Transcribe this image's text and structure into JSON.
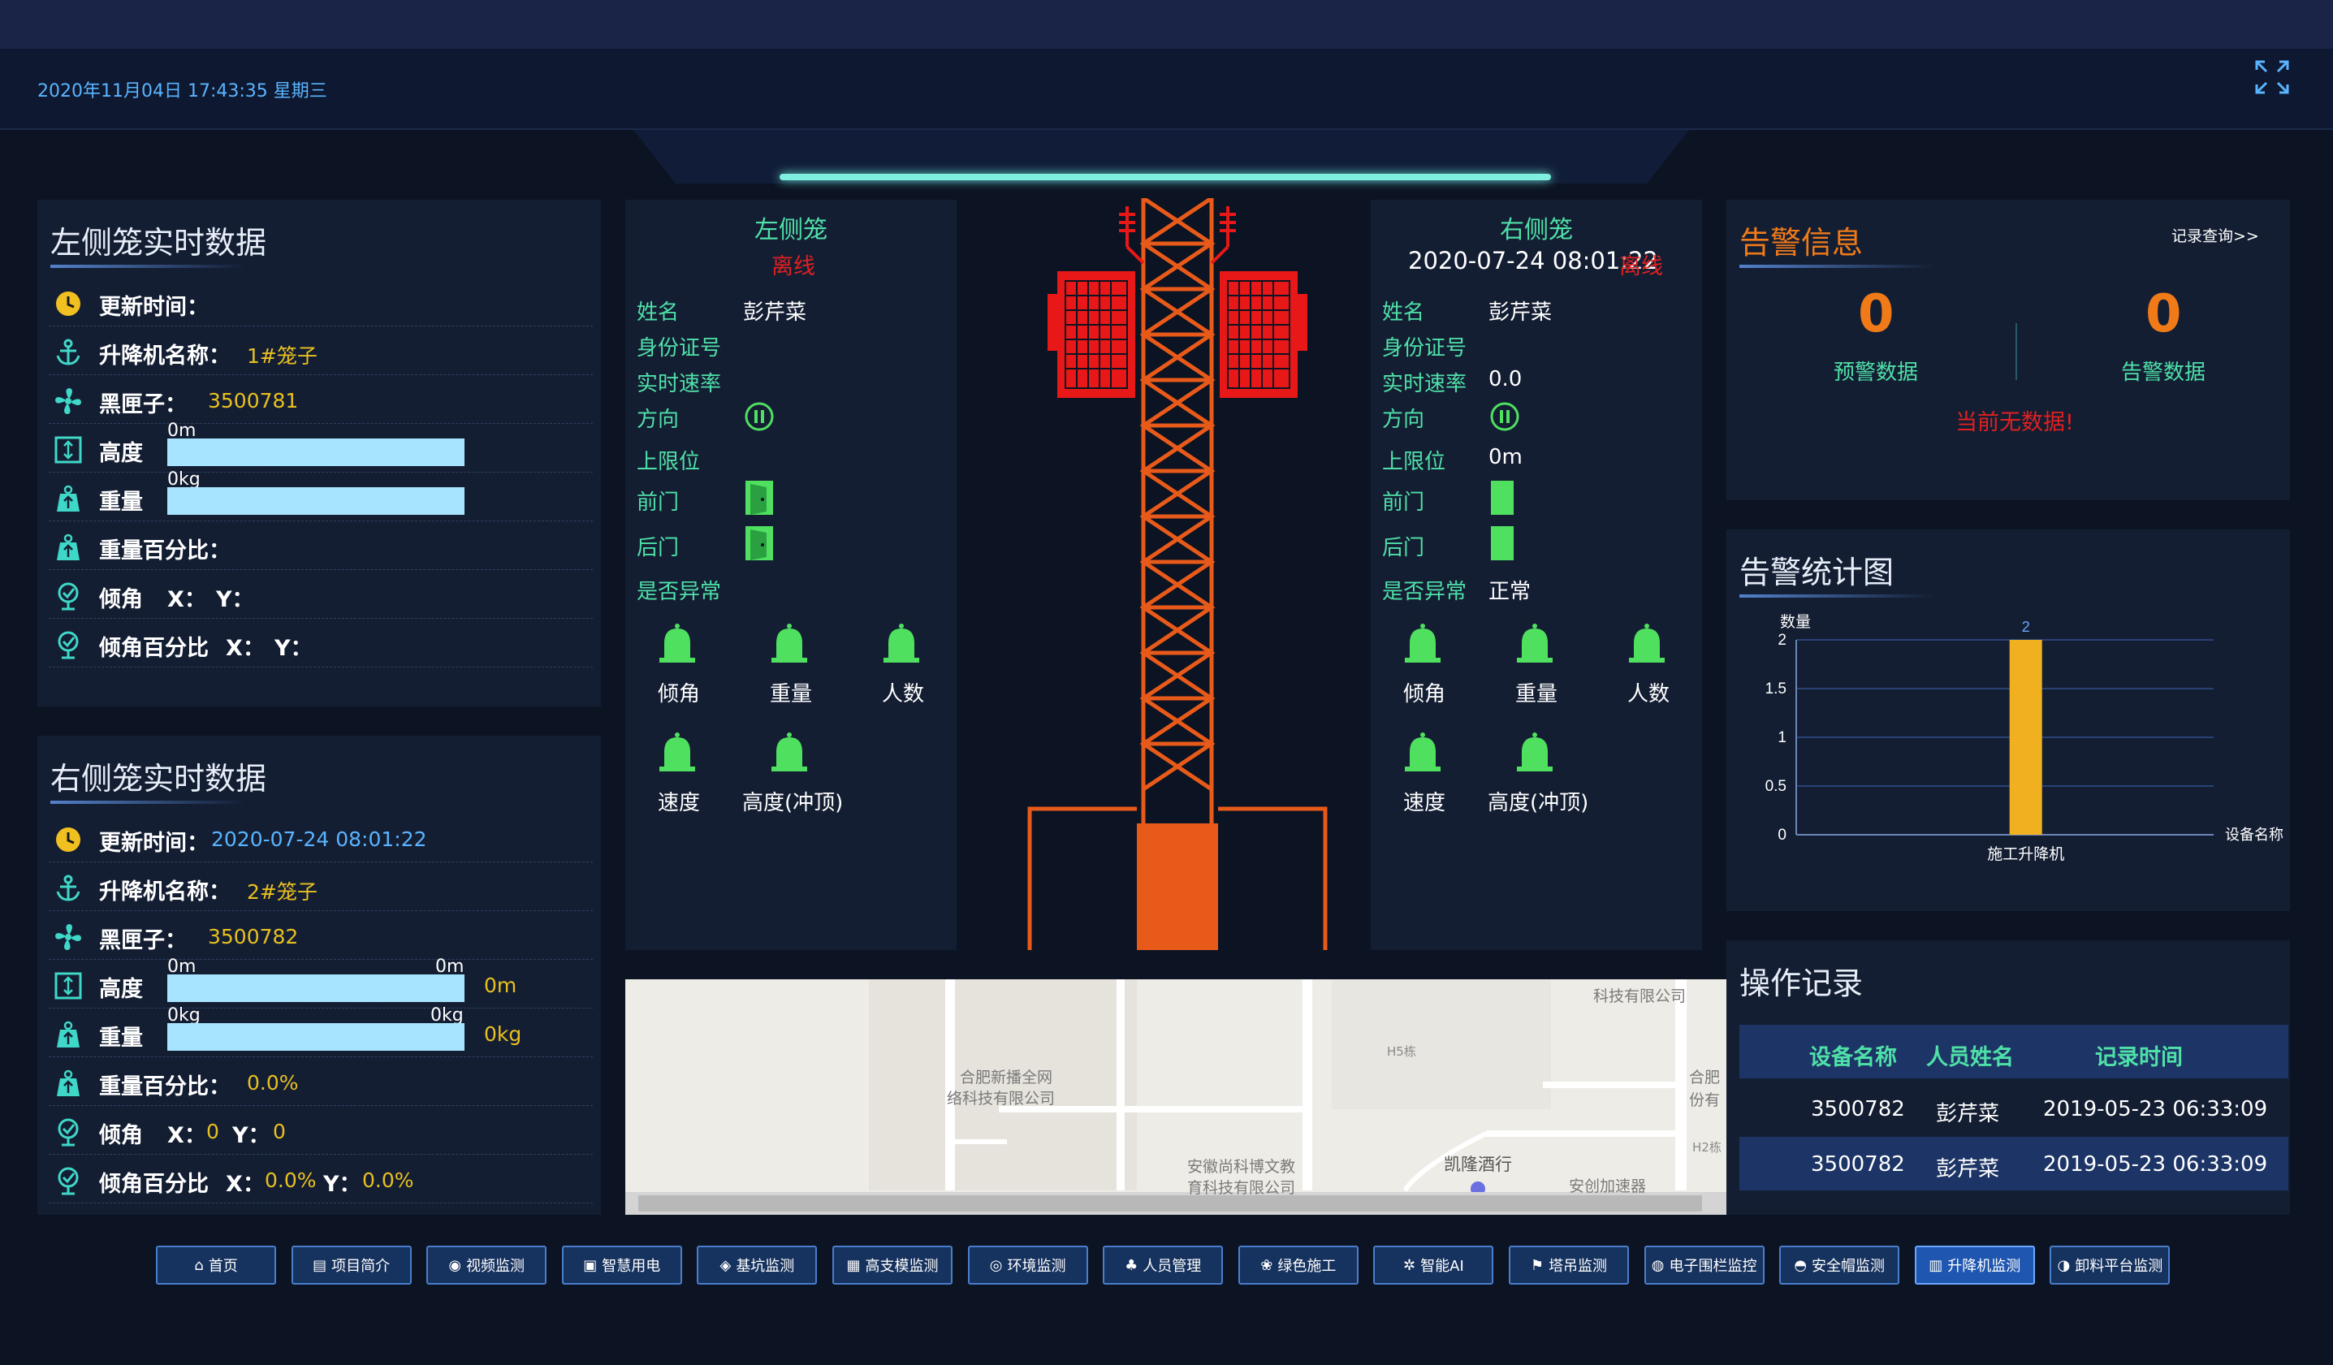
{
  "header": {
    "datetime": "2020年11月04日 17:43:35  星期三"
  },
  "left_data": {
    "title": "左侧笼实时数据",
    "update_label": "更新时间：",
    "update_value": "",
    "hoist_label": "升降机名称：",
    "hoist_value": "1#笼子",
    "blackbox_label": "黑匣子：",
    "blackbox_value": "3500781",
    "height_label": "高度",
    "height_bar_left": "0m",
    "weight_label": "重量",
    "weight_bar_left": "0kg",
    "weight_pct_label": "重量百分比：",
    "tilt_label": "倾角",
    "tilt_x": "X：",
    "tilt_y": "Y：",
    "tilt_pct_label": "倾角百分比",
    "tilt_pct_x": "X：",
    "tilt_pct_y": "Y："
  },
  "right_data": {
    "title": "右侧笼实时数据",
    "update_label": "更新时间：",
    "update_value": "2020-07-24 08:01:22",
    "hoist_label": "升降机名称：",
    "hoist_value": "2#笼子",
    "blackbox_label": "黑匣子：",
    "blackbox_value": "3500782",
    "height_label": "高度",
    "height_bar_left": "0m",
    "height_bar_right": "0m",
    "height_value": "0m",
    "weight_label": "重量",
    "weight_bar_left": "0kg",
    "weight_bar_right": "0kg",
    "weight_value": "0kg",
    "weight_pct_label": "重量百分比：",
    "weight_pct_value": "0.0%",
    "tilt_label": "倾角",
    "tilt_x": "X：",
    "tilt_x_value": "0",
    "tilt_y": "Y：",
    "tilt_y_value": "0",
    "tilt_pct_label": "倾角百分比",
    "tilt_pct_x": "X：",
    "tilt_pct_x_value": "0.0%",
    "tilt_pct_y": "Y：",
    "tilt_pct_y_value": "0.0%"
  },
  "left_cage": {
    "title": "左侧笼",
    "status": "离线",
    "rows": {
      "name_label": "姓名",
      "name_value": "彭芹菜",
      "id_label": "身份证号",
      "speed_label": "实时速率",
      "dir_label": "方向",
      "limit_label": "上限位",
      "front_label": "前门",
      "back_label": "后门",
      "abnormal_label": "是否异常"
    },
    "bells": [
      "倾角",
      "重量",
      "人数",
      "速度",
      "高度(冲顶)"
    ]
  },
  "right_cage": {
    "title": "右侧笼",
    "date": "2020-07-24 08:01:22",
    "status": "离线",
    "rows": {
      "name_label": "姓名",
      "name_value": "彭芹菜",
      "id_label": "身份证号",
      "speed_label": "实时速率",
      "speed_value": "0.0",
      "dir_label": "方向",
      "limit_label": "上限位",
      "limit_value": "0m",
      "front_label": "前门",
      "back_label": "后门",
      "abnormal_label": "是否异常",
      "abnormal_value": "正常"
    },
    "bells": [
      "倾角",
      "重量",
      "人数",
      "速度",
      "高度(冲顶)"
    ]
  },
  "alarm_info": {
    "title": "告警信息",
    "record_link": "记录查询>>",
    "warn_count": "0",
    "warn_label": "预警数据",
    "alarm_count": "0",
    "alarm_label": "告警数据",
    "empty_text": "当前无数据!"
  },
  "alarm_chart": {
    "title": "告警统计图"
  },
  "chart_data": {
    "type": "bar",
    "categories": [
      "施工升降机"
    ],
    "values": [
      2
    ],
    "ylabel": "数量",
    "xlabel": "设备名称",
    "ylim": [
      0,
      2
    ],
    "yticks": [
      "0",
      "0.5",
      "1",
      "1.5",
      "2"
    ],
    "data_labels": [
      "2"
    ],
    "bar_color": "#f0b020",
    "grid": true
  },
  "map": {
    "labels": [
      "科技有限公司",
      "合肥新播全网",
      "络科技有限公司",
      "H5栋",
      "合肥",
      "份有",
      "H2栋",
      "安徽尚科博文教",
      "育科技有限公司",
      "凯隆酒行",
      "安创加速器"
    ]
  },
  "op_records": {
    "title": "操作记录",
    "headers": [
      "设备名称",
      "人员姓名",
      "记录时间"
    ],
    "rows": [
      [
        "3500782",
        "彭芹菜",
        "2019-05-23 06:33:09"
      ],
      [
        "3500782",
        "彭芹菜",
        "2019-05-23 06:33:09"
      ]
    ]
  },
  "nav": [
    {
      "label": "首页",
      "icon": "home-icon"
    },
    {
      "label": "项目简介",
      "icon": "document-icon"
    },
    {
      "label": "视频监测",
      "icon": "camera-icon"
    },
    {
      "label": "智慧用电",
      "icon": "power-icon"
    },
    {
      "label": "基坑监测",
      "icon": "pin-icon"
    },
    {
      "label": "高支模监测",
      "icon": "grid-icon"
    },
    {
      "label": "环境监测",
      "icon": "environment-icon"
    },
    {
      "label": "人员管理",
      "icon": "people-icon"
    },
    {
      "label": "绿色施工",
      "icon": "green-icon"
    },
    {
      "label": "智能AI",
      "icon": "ai-icon"
    },
    {
      "label": "塔吊监测",
      "icon": "crane-icon"
    },
    {
      "label": "电子围栏监控",
      "icon": "fence-icon"
    },
    {
      "label": "安全帽监测",
      "icon": "helmet-icon"
    },
    {
      "label": "升降机监测",
      "icon": "elevator-icon",
      "active": true
    },
    {
      "label": "卸料平台监测",
      "icon": "platform-icon"
    }
  ],
  "colors": {
    "accent_green": "#4fe0a8",
    "alarm_red": "#e02020",
    "orange": "#f07a18",
    "tower_orange": "#e85a1a",
    "cage_red": "#e81818"
  }
}
